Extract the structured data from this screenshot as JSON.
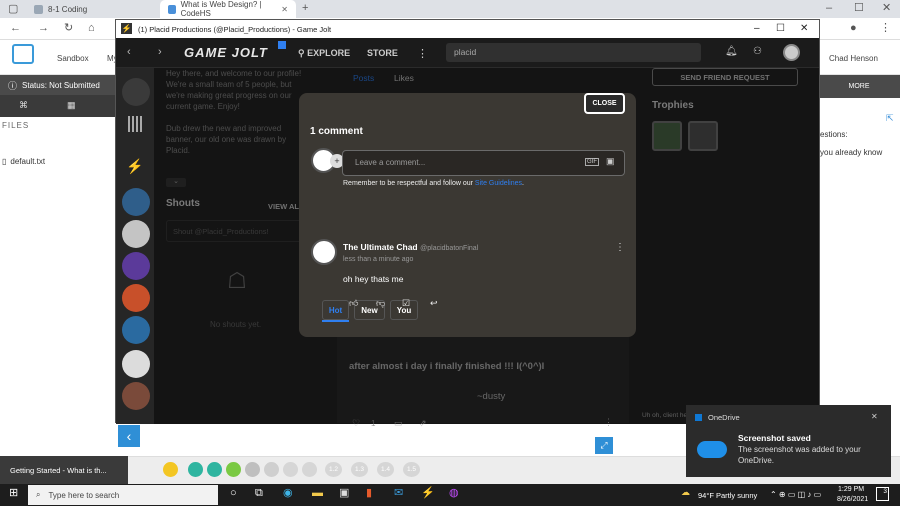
{
  "browser": {
    "tabs": [
      {
        "label": "8-1 Coding",
        "color": "#9aa7b5"
      },
      {
        "label": "What is Web Design? | CodeHS",
        "color": "#4a90d9"
      }
    ],
    "new_tab": "+",
    "window_controls": {
      "min": "–",
      "max": "☐",
      "close": "✕"
    }
  },
  "codehs": {
    "sandbox_label": "Sandbox",
    "my_label": "My",
    "user_name": "Chad Henson",
    "status": "Status: Not Submitted",
    "files_label": "FILES",
    "file_name": "default.txt",
    "more_label": "MORE",
    "right_text_1": "estions:",
    "right_text_2": "you already know",
    "getting_started": "Getting Started - What is th...",
    "steps": [
      "1.2",
      "1.3",
      "1.4",
      "1.5"
    ]
  },
  "gj": {
    "window_title": "(1) Placid Productions (@Placid_Productions) - Game Jolt",
    "window_controls": {
      "min": "–",
      "max": "☐",
      "close": "✕"
    },
    "logo": "GAME JOLT",
    "explore": "EXPLORE",
    "store": "STORE",
    "search_value": "placid",
    "about_1": "Hey there, and welcome to our profile!",
    "about_2": "We're a small team of 5 people, but",
    "about_3": "we're making great progress on our",
    "about_4": "current game. Enjoy!",
    "about_5": "Dub drew the new and improved",
    "about_6": "banner, our old one was drawn by",
    "about_7": "Placid.",
    "posts_tab": "Posts",
    "likes_tab": "Likes",
    "send_friend": "SEND FRIEND REQUEST",
    "trophies": "Trophies",
    "shouts": "Shouts",
    "view_all": "VIEW AL",
    "shout_placeholder": "Shout @Placid_Productions!",
    "no_shouts": "No shouts yet.",
    "post_text": "after almost i day i finally finished !!! I(^0^)I",
    "post_sig": "~dusty",
    "like_count": "1",
    "footer_hint": "Uh oh, client he"
  },
  "modal": {
    "close_label": "CLOSE",
    "heading": "1 comment",
    "input_placeholder": "Leave a comment...",
    "guidelines_prefix": "Remember to be respectful and follow our",
    "guidelines_link": "Site Guidelines",
    "guidelines_suffix": ".",
    "filter_tabs": [
      "Hot",
      "New",
      "You"
    ],
    "comment": {
      "author": "The Ultimate Chad",
      "handle": "@placidbatonFinal",
      "time": "less than a minute ago",
      "body": "oh hey thats me"
    },
    "accent": "#2f7ff0"
  },
  "toast": {
    "app": "OneDrive",
    "title": "Screenshot saved",
    "body_1": "The screenshot was added to your",
    "body_2": "OneDrive."
  },
  "taskbar": {
    "search_placeholder": "Type here to search",
    "weather": "94°F  Partly sunny",
    "time": "1:29 PM",
    "date": "8/26/2021",
    "notif_count": "3"
  }
}
